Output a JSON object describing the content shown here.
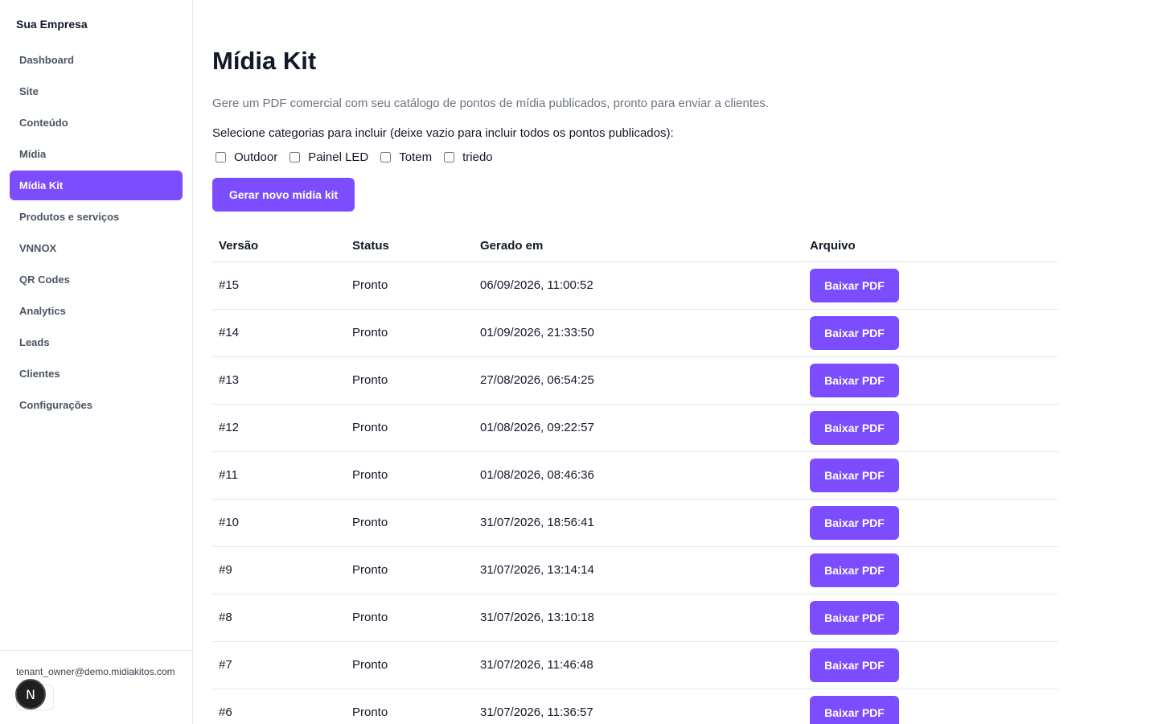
{
  "sidebar": {
    "brand": "Sua Empresa",
    "items": [
      {
        "label": "Dashboard",
        "active": false
      },
      {
        "label": "Site",
        "active": false
      },
      {
        "label": "Conteúdo",
        "active": false
      },
      {
        "label": "Mídia",
        "active": false
      },
      {
        "label": "Mídia Kit",
        "active": true
      },
      {
        "label": "Produtos e serviços",
        "active": false
      },
      {
        "label": "VNNOX",
        "active": false
      },
      {
        "label": "QR Codes",
        "active": false
      },
      {
        "label": "Analytics",
        "active": false
      },
      {
        "label": "Leads",
        "active": false
      },
      {
        "label": "Clientes",
        "active": false
      },
      {
        "label": "Configurações",
        "active": false
      }
    ],
    "user_email": "tenant_owner@demo.midiakitos.com"
  },
  "dev_badge": {
    "letter": "N"
  },
  "main": {
    "title": "Mídia Kit",
    "subtitle": "Gere um PDF comercial com seu catálogo de pontos de mídia publicados, pronto para enviar a clientes.",
    "category_label": "Selecione categorias para incluir (deixe vazio para incluir todos os pontos publicados):",
    "categories": [
      {
        "label": "Outdoor",
        "checked": false
      },
      {
        "label": "Painel LED",
        "checked": false
      },
      {
        "label": "Totem",
        "checked": false
      },
      {
        "label": "triedo",
        "checked": false
      }
    ],
    "generate_button": "Gerar novo mídia kit",
    "table": {
      "headers": [
        "Versão",
        "Status",
        "Gerado em",
        "Arquivo"
      ],
      "download_label": "Baixar PDF",
      "rows": [
        {
          "version": "#15",
          "status": "Pronto",
          "generated_at": "06/09/2026, 11:00:52"
        },
        {
          "version": "#14",
          "status": "Pronto",
          "generated_at": "01/09/2026, 21:33:50"
        },
        {
          "version": "#13",
          "status": "Pronto",
          "generated_at": "27/08/2026, 06:54:25"
        },
        {
          "version": "#12",
          "status": "Pronto",
          "generated_at": "01/08/2026, 09:22:57"
        },
        {
          "version": "#11",
          "status": "Pronto",
          "generated_at": "01/08/2026, 08:46:36"
        },
        {
          "version": "#10",
          "status": "Pronto",
          "generated_at": "31/07/2026, 18:56:41"
        },
        {
          "version": "#9",
          "status": "Pronto",
          "generated_at": "31/07/2026, 13:14:14"
        },
        {
          "version": "#8",
          "status": "Pronto",
          "generated_at": "31/07/2026, 13:10:18"
        },
        {
          "version": "#7",
          "status": "Pronto",
          "generated_at": "31/07/2026, 11:46:48"
        },
        {
          "version": "#6",
          "status": "Pronto",
          "generated_at": "31/07/2026, 11:36:57"
        }
      ]
    }
  },
  "colors": {
    "accent": "#7c4dff",
    "muted": "#6b7280",
    "border": "#e5e7eb"
  }
}
